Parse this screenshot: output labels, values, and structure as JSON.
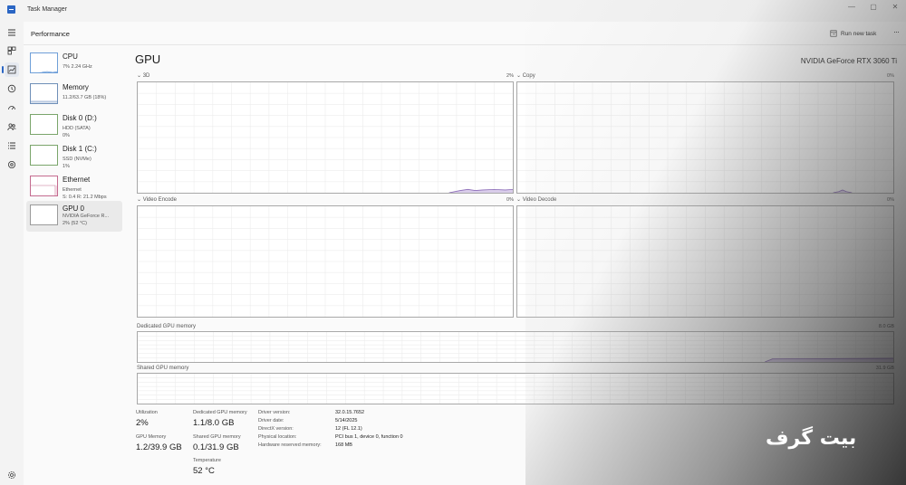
{
  "window": {
    "app_title": "Task Manager",
    "minimize": "—",
    "maximize": "▢",
    "close": "✕"
  },
  "header": {
    "page_title": "Performance",
    "run_new_task": "Run new task",
    "more": "···"
  },
  "devices": [
    {
      "name": "CPU",
      "line1": "7% 2.24 GHz",
      "line2": ""
    },
    {
      "name": "Memory",
      "line1": "11.2/63.7 GB (18%)",
      "line2": ""
    },
    {
      "name": "Disk 0 (D:)",
      "line1": "HDD (SATA)",
      "line2": "0%"
    },
    {
      "name": "Disk 1 (C:)",
      "line1": "SSD (NVMe)",
      "line2": "1%"
    },
    {
      "name": "Ethernet",
      "line1": "Ethernet",
      "line2": "S: 0.4 R: 21.2 Mbps"
    },
    {
      "name": "GPU 0",
      "line1": "NVIDIA GeForce R...",
      "line2": "2% (52 °C)"
    }
  ],
  "gpu": {
    "title": "GPU",
    "model": "NVIDIA GeForce RTX 3060 Ti",
    "engines": [
      {
        "label": "3D",
        "percent": "2%"
      },
      {
        "label": "Copy",
        "percent": "0%"
      },
      {
        "label": "Video Encode",
        "percent": "0%"
      },
      {
        "label": "Video Decode",
        "percent": "0%"
      }
    ],
    "dedicated_memory_graph": {
      "label": "Dedicated GPU memory",
      "max": "8.0 GB"
    },
    "shared_memory_graph": {
      "label": "Shared GPU memory",
      "max": "31.9 GB"
    }
  },
  "stats": {
    "utilization_label": "Utilization",
    "utilization_value": "2%",
    "gpu_memory_label": "GPU Memory",
    "gpu_memory_value": "1.2/39.9 GB",
    "dedicated_label": "Dedicated GPU memory",
    "dedicated_value": "1.1/8.0 GB",
    "shared_label": "Shared GPU memory",
    "shared_value": "0.1/31.9 GB",
    "temperature_label": "Temperature",
    "temperature_value": "52 °C"
  },
  "info": [
    {
      "key": "Driver version:",
      "value": "32.0.15.7652"
    },
    {
      "key": "Driver date:",
      "value": "5/14/2025"
    },
    {
      "key": "DirectX version:",
      "value": "12 (FL 12.1)"
    },
    {
      "key": "Physical location:",
      "value": "PCI bus 1, device 0, function 0"
    },
    {
      "key": "Hardware reserved memory:",
      "value": "168 MB"
    }
  ],
  "watermark": "بیت گرف",
  "colors": {
    "graph_line": "#8c6bb8",
    "graph_fill": "#d9cdea",
    "grid": "#ececec",
    "accent": "#2b66c4"
  },
  "icons": [
    "menu-icon",
    "processes-icon",
    "performance-icon",
    "app-history-icon",
    "startup-apps-icon",
    "users-icon",
    "details-icon",
    "services-icon",
    "settings-icon",
    "run-task-icon"
  ]
}
